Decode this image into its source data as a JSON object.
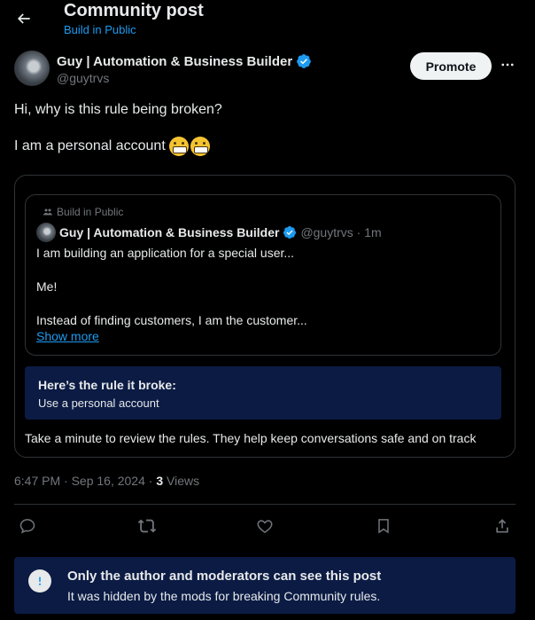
{
  "header": {
    "title": "Community post",
    "community": "Build in Public"
  },
  "author": {
    "name": "Guy | Automation & Business Builder",
    "handle": "@guytrvs",
    "verified": true
  },
  "actions_top": {
    "promote_label": "Promote"
  },
  "post": {
    "line1": "Hi, why is this rule being broken?",
    "line2": "I am a personal account",
    "line2_emojis": [
      "grimacing-face",
      "grimacing-face"
    ]
  },
  "notice": {
    "quoted": {
      "community": "Build in Public",
      "author_name": "Guy | Automation & Business Builder",
      "author_handle": "@guytrvs · 1m",
      "body": [
        "I am building an application for a special user...",
        "Me!",
        "Instead of finding customers, I am the customer..."
      ],
      "show_more": "Show more"
    },
    "rule_title": "Here’s the rule it broke:",
    "rule_text": "Use a personal account",
    "review_text": "Take a minute to review the rules. They help keep conversations safe and on track"
  },
  "meta": {
    "time_date": "6:47 PM · Sep 16, 2024 · ",
    "views_count": "3",
    "views_label": " Views"
  },
  "bottom_actions": [
    "reply-icon",
    "repost-icon",
    "like-icon",
    "bookmark-icon",
    "share-icon"
  ],
  "hidden_banner": {
    "title": "Only the author and moderators can see this post",
    "description": "It was hidden by the mods for breaking Community rules."
  },
  "colors": {
    "background": "#000000",
    "accent": "#1d9bf0",
    "banner": "#0b1b44",
    "muted": "#71767b",
    "border": "#2f3336"
  }
}
